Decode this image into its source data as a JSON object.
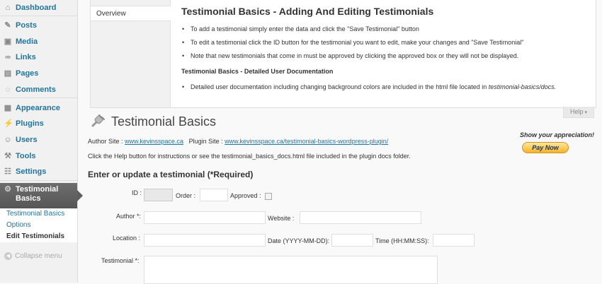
{
  "sidebar": {
    "items": [
      {
        "label": "Dashboard",
        "icon": "dashboard-icon"
      },
      {
        "label": "Posts",
        "icon": "pushpin-icon"
      },
      {
        "label": "Media",
        "icon": "media-icon"
      },
      {
        "label": "Links",
        "icon": "link-icon"
      },
      {
        "label": "Pages",
        "icon": "pages-icon"
      },
      {
        "label": "Comments",
        "icon": "comment-icon"
      },
      {
        "label": "Appearance",
        "icon": "appearance-icon"
      },
      {
        "label": "Plugins",
        "icon": "plugin-icon"
      },
      {
        "label": "Users",
        "icon": "users-icon"
      },
      {
        "label": "Tools",
        "icon": "tools-icon"
      },
      {
        "label": "Settings",
        "icon": "settings-icon"
      }
    ],
    "active": {
      "label_line1": "Testimonial",
      "label_line2": "Basics",
      "icon": "gear-icon"
    },
    "submenu": [
      "Testimonial Basics",
      "Options",
      "Edit Testimonials"
    ],
    "collapse_label": "Collapse menu"
  },
  "help": {
    "tab": "Overview",
    "title": "Testimonial Basics - Adding And Editing Testimonials",
    "bullets": [
      "To add a testimonial simply enter the data and click the \"Save Testimonial\" button",
      "To edit a testimonial click the ID button for the testimonial you want to edit, make your changes and \"Save Testimonial\"",
      "Note that new testimonials that come in must be approved by clicking the approved box or they will not be displayed."
    ],
    "subtitle": "Testimonial Basics - Detailed User Documentation",
    "doc_text": "Detailed user documentation including changing background colors are included in the html file located in ",
    "doc_path": "testimonial-basics/docs.",
    "button": "Help"
  },
  "page": {
    "title": "Testimonial Basics",
    "author_site_label": "Author Site : ",
    "author_site_url": "www.kevinsspace.ca",
    "plugin_site_label": "Plugin Site : ",
    "plugin_site_url": "www.kevinsspace.ca/testimonial-basics-wordpress-plugin/",
    "instructions": "Click the Help button for instructions or see the testimonial_basics_docs.html file included in the plugin docs folder.",
    "appreciation": "Show your appreciation!",
    "pay_now": "Pay Now"
  },
  "form": {
    "title": "Enter or update a testimonial (*Required)",
    "id_label": "ID :",
    "order_label": "Order :",
    "approved_label": "Approved :",
    "author_label": "Author *:",
    "website_label": "Website :",
    "location_label": "Location :",
    "date_label": "Date (YYYY-MM-DD):",
    "time_label": "Time (HH:MM:SS):",
    "testimonial_label": "Testimonial *:",
    "values": {
      "id": "",
      "order": "",
      "author": "",
      "website": "",
      "location": "",
      "date": "",
      "time": ""
    }
  }
}
